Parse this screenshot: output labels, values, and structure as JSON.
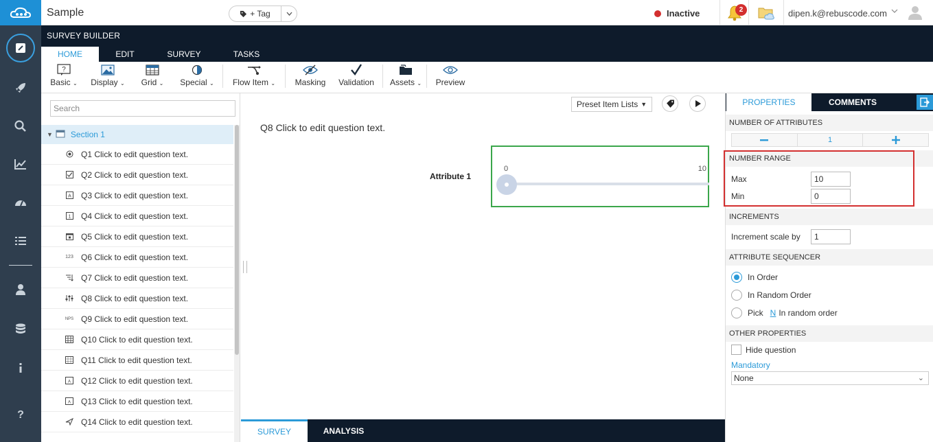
{
  "header": {
    "app_title": "Sample",
    "tag_label": "+ Tag",
    "status": "Inactive",
    "notification_count": "2",
    "user_email": "dipen.k@rebuscode.com"
  },
  "ribbon": {
    "title": "SURVEY BUILDER",
    "tabs": [
      {
        "label": "HOME",
        "active": true
      },
      {
        "label": "EDIT",
        "active": false
      },
      {
        "label": "SURVEY",
        "active": false
      },
      {
        "label": "TASKS",
        "active": false
      }
    ]
  },
  "toolbar": {
    "basic": "Basic",
    "display": "Display",
    "grid": "Grid",
    "special": "Special",
    "flow_item": "Flow Item",
    "masking": "Masking",
    "validation": "Validation",
    "assets": "Assets",
    "preview": "Preview"
  },
  "tree": {
    "search_placeholder": "Search",
    "section": "Section 1",
    "questions": [
      {
        "label": "Q1 Click to edit question text.",
        "icon": "radio-icon"
      },
      {
        "label": "Q2 Click to edit question text.",
        "icon": "checkbox-icon"
      },
      {
        "label": "Q3 Click to edit question text.",
        "icon": "text-a-icon"
      },
      {
        "label": "Q4 Click to edit question text.",
        "icon": "number-icon"
      },
      {
        "label": "Q5 Click to edit question text.",
        "icon": "calendar-icon"
      },
      {
        "label": "Q6 Click to edit question text.",
        "icon": "numeric-123-icon"
      },
      {
        "label": "Q7 Click to edit question text.",
        "icon": "rank-list-icon"
      },
      {
        "label": "Q8 Click to edit question text.",
        "icon": "slider-icon"
      },
      {
        "label": "Q9 Click to edit question text.",
        "icon": "nps-icon"
      },
      {
        "label": "Q10 Click to edit question text.",
        "icon": "grid-icon"
      },
      {
        "label": "Q11 Click to edit question text.",
        "icon": "grid-icon"
      },
      {
        "label": "Q12 Click to edit question text.",
        "icon": "grid-text-icon"
      },
      {
        "label": "Q13 Click to edit question text.",
        "icon": "grid-text-icon"
      },
      {
        "label": "Q14 Click to edit question text.",
        "icon": "send-icon"
      }
    ]
  },
  "canvas": {
    "preset_label": "Preset Item Lists",
    "question_title": "Q8  Click to edit question text.",
    "attribute_label": "Attribute 1",
    "slider_min": "0",
    "slider_max": "10",
    "slider_value": 0
  },
  "bottom_tabs": {
    "survey": "SURVEY",
    "analysis": "ANALYSIS"
  },
  "properties": {
    "tab_properties": "PROPERTIES",
    "tab_comments": "COMMENTS",
    "number_of_attributes_header": "NUMBER OF ATTRIBUTES",
    "attributes_count": "1",
    "number_range_header": "NUMBER RANGE",
    "max_label": "Max",
    "max_value": "10",
    "min_label": "Min",
    "min_value": "0",
    "increments_header": "INCREMENTS",
    "increment_label": "Increment scale by",
    "increment_value": "1",
    "sequencer_header": "ATTRIBUTE SEQUENCER",
    "seq_in_order": "In Order",
    "seq_random": "In Random Order",
    "seq_pick": "Pick",
    "seq_pick_n": "N",
    "seq_pick_suffix": "In random order",
    "other_header": "OTHER PROPERTIES",
    "hide_question": "Hide question",
    "mandatory_label": "Mandatory",
    "mandatory_value": "None"
  },
  "colors": {
    "accent": "#2b9ad8",
    "rail": "#2f3e4e",
    "ribbon": "#0e1b2b",
    "status_inactive": "#d32f2f",
    "slider_highlight": "#3aa64a",
    "range_highlight": "#d32f2f"
  }
}
